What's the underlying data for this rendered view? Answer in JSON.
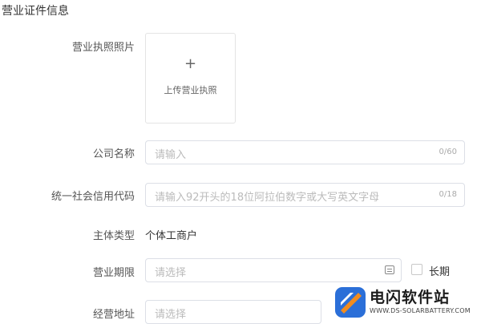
{
  "section": {
    "title": "营业证件信息"
  },
  "license_photo": {
    "label": "营业执照照片",
    "upload_plus": "+",
    "upload_text": "上传营业执照"
  },
  "company_name": {
    "label": "公司名称",
    "placeholder": "请输入",
    "counter": "0/60"
  },
  "credit_code": {
    "label": "统一社会信用代码",
    "placeholder": "请输入92开头的18位阿拉伯数字或大写英文字母",
    "counter": "0/18"
  },
  "entity_type": {
    "label": "主体类型",
    "value": "个体工商户"
  },
  "business_term": {
    "label": "营业期限",
    "placeholder": "请选择",
    "calendar_icon": "calendar-icon",
    "long_term_label": "长期",
    "long_term_checked": false
  },
  "business_address": {
    "label": "经营地址",
    "placeholder": "请选择"
  },
  "watermark": {
    "title": "电闪软件站",
    "subtitle": "WWW.DS-SOLARBATTERY.COM",
    "colors": {
      "blue": "#2b6fd8",
      "orange": "#f28c1e"
    }
  }
}
